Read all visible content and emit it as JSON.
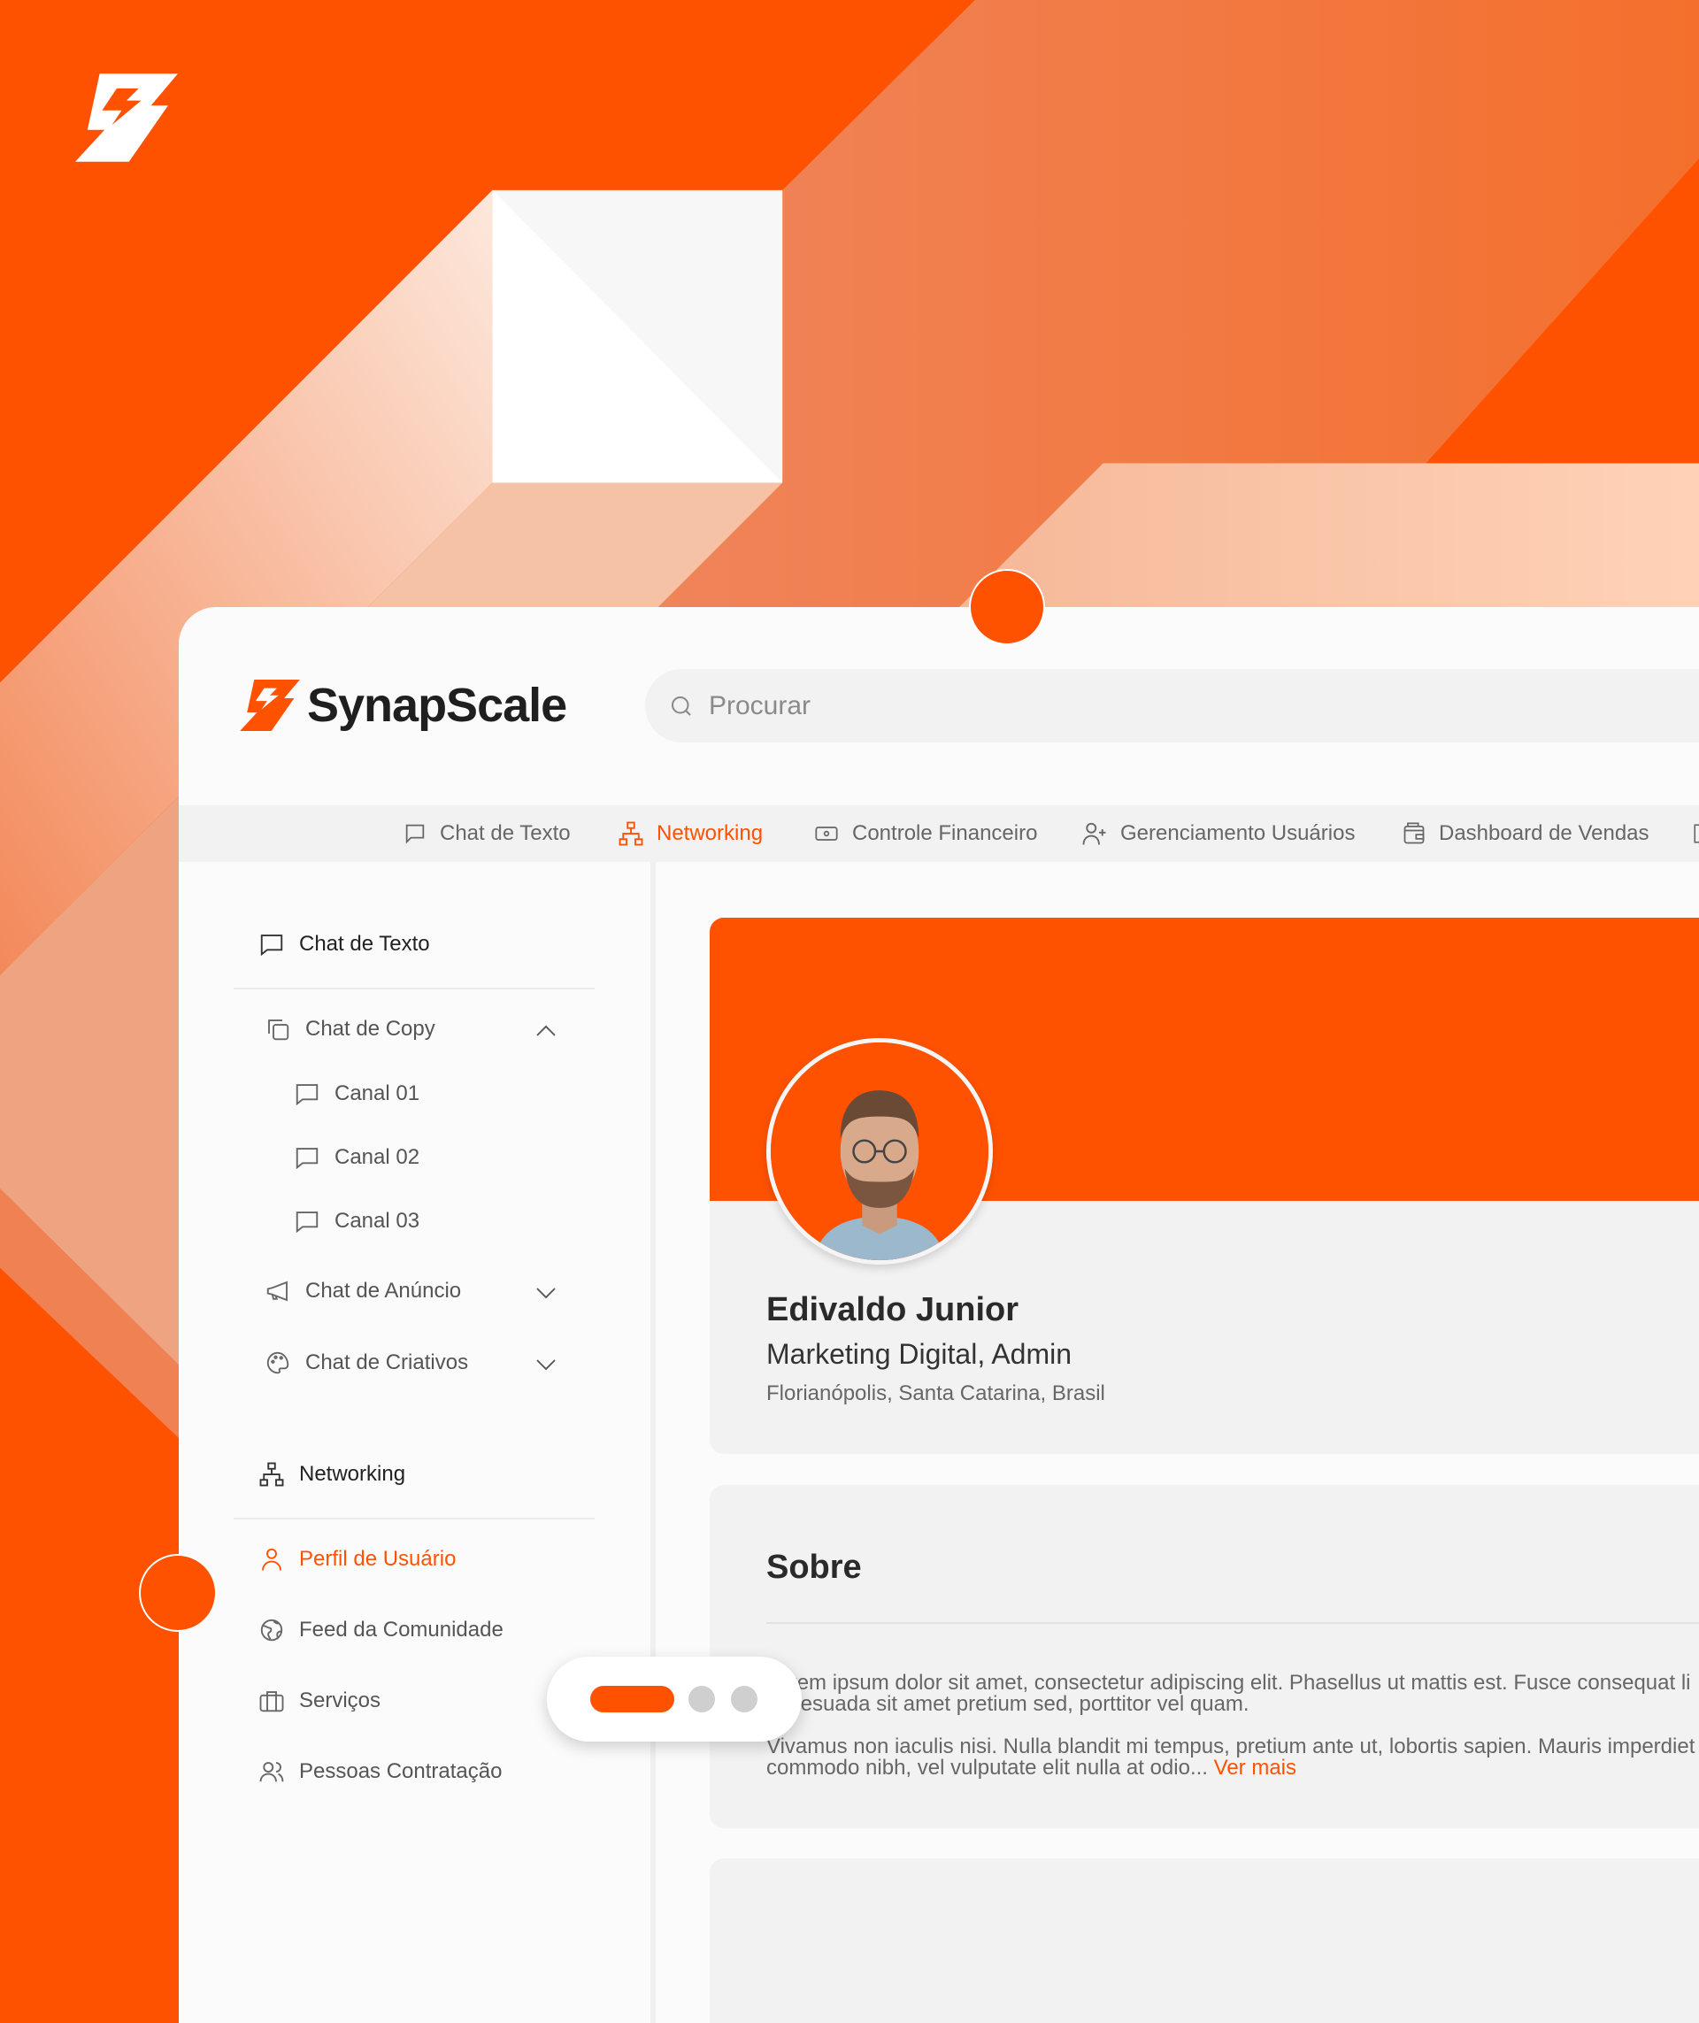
{
  "colors": {
    "brand": "#ff5200",
    "panel": "#f2f2f2",
    "text": "#2a2a2a"
  },
  "brand": {
    "name": "SynapScale",
    "logo_icon": "lightning-bolt-icon"
  },
  "search": {
    "placeholder": "Procurar",
    "icon": "search-icon"
  },
  "top_nav": [
    {
      "label": "Chat de Texto",
      "icon": "chat-bubble-icon",
      "active": false
    },
    {
      "label": "Networking",
      "icon": "network-icon",
      "active": true
    },
    {
      "label": "Controle Financeiro",
      "icon": "money-icon",
      "active": false
    },
    {
      "label": "Gerenciamento Usuários",
      "icon": "user-add-icon",
      "active": false
    },
    {
      "label": "Dashboard de Vendas",
      "icon": "wallet-icon",
      "active": false
    }
  ],
  "sidebar": {
    "chat_de_texto": "Chat de Texto",
    "chat_de_copy": "Chat de Copy",
    "canais": [
      "Canal 01",
      "Canal 02",
      "Canal 03"
    ],
    "chat_de_anuncio": "Chat de Anúncio",
    "chat_de_criativos": "Chat de Criativos",
    "networking": "Networking",
    "perfil": "Perfil de Usuário",
    "feed": "Feed da Comunidade",
    "servicos": "Serviços",
    "pessoas": "Pessoas Contratação"
  },
  "profile": {
    "name": "Edivaldo Junior",
    "role": "Marketing Digital, Admin",
    "location": "Florianópolis, Santa Catarina, Brasil"
  },
  "about": {
    "title": "Sobre",
    "paragraph1_line1": "Lorem ipsum dolor sit amet, consectetur adipiscing elit. Phasellus ut mattis est. Fusce consequat li",
    "paragraph1_line2": "malesuada sit amet pretium sed, porttitor vel quam.",
    "paragraph2_line1": "Vivamus non iaculis nisi. Nulla blandit mi tempus, pretium ante ut, lobortis sapien. Mauris imperdiet",
    "paragraph2_line2": "commodo nibh, vel vulputate elit nulla at odio... ",
    "more_link": "Ver mais"
  },
  "carousel": {
    "slides": 3,
    "active_index": 0
  }
}
